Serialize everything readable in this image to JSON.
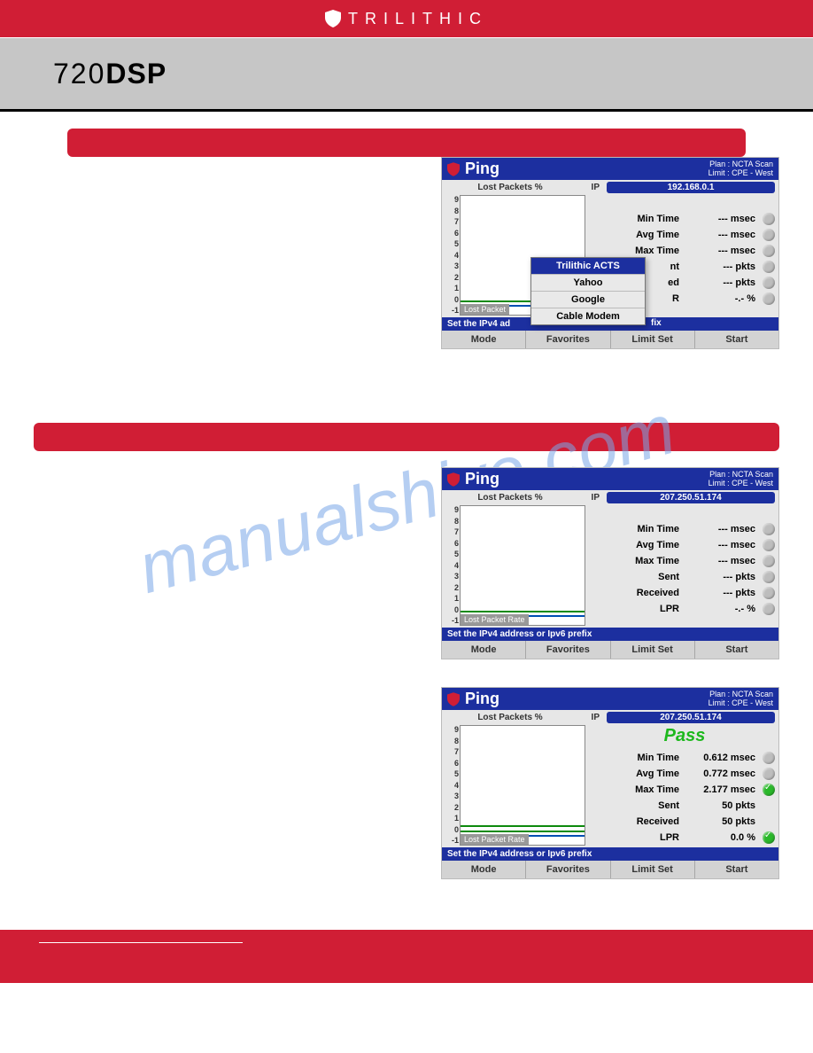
{
  "brand": "TRILITHIC",
  "product": {
    "num": "720",
    "suffix": "DSP"
  },
  "watermark": "manualshive.com",
  "ping_common": {
    "title": "Ping",
    "plan": "Plan : NCTA Scan",
    "limit": "Limit : CPE - West",
    "subhead_lpk": "Lost Packets %",
    "subhead_ip": "IP",
    "lpr_label": "Lost Packet Rate",
    "bluebar": "Set the IPv4 address or Ipv6 prefix",
    "bluebar_trunc": "Set the IPv4 ad",
    "bluebar_sfx": "fix",
    "softkeys": [
      "Mode",
      "Favorites",
      "Limit Set",
      "Start"
    ],
    "yticks": [
      "9",
      "8",
      "7",
      "6",
      "5",
      "4",
      "3",
      "2",
      "1",
      "0",
      "-1"
    ]
  },
  "favorites_menu": [
    "Trilithic ACTS",
    "Yahoo",
    "Google",
    "Cable Modem"
  ],
  "panels": [
    {
      "id": "p1",
      "offset_top": 0,
      "ip": "192.168.0.1",
      "has_favmenu": true,
      "trunc_bluebar": true,
      "rows": [
        {
          "label": "Min Time",
          "value": "--- msec",
          "stat": "gray"
        },
        {
          "label": "Avg Time",
          "value": "--- msec",
          "stat": "gray"
        },
        {
          "label": "Max Time",
          "value": "--- msec",
          "stat": "gray"
        },
        {
          "label": "nt",
          "value": "--- pkts",
          "stat": "gray",
          "half": true
        },
        {
          "label": "ed",
          "value": "--- pkts",
          "stat": "gray",
          "half": true
        },
        {
          "label": "R",
          "value": "-.- %",
          "stat": "gray",
          "half": true
        }
      ],
      "lines": [
        {
          "c": "lg",
          "b": 118
        },
        {
          "c": "lb",
          "b": 123
        }
      ],
      "lpr_short": "Lost Packet"
    },
    {
      "id": "p2",
      "offset_top": 0,
      "ip": "207.250.51.174",
      "has_favmenu": false,
      "trunc_bluebar": false,
      "rows": [
        {
          "label": "Min Time",
          "value": "--- msec",
          "stat": "gray"
        },
        {
          "label": "Avg Time",
          "value": "--- msec",
          "stat": "gray"
        },
        {
          "label": "Max Time",
          "value": "--- msec",
          "stat": "gray"
        },
        {
          "label": "Sent",
          "value": "--- pkts",
          "stat": "gray"
        },
        {
          "label": "Received",
          "value": "--- pkts",
          "stat": "gray"
        },
        {
          "label": "LPR",
          "value": "-.- %",
          "stat": "gray"
        }
      ],
      "lines": [
        {
          "c": "lg",
          "b": 118
        },
        {
          "c": "lb",
          "b": 123
        }
      ]
    },
    {
      "id": "p3",
      "offset_top": 18,
      "ip": "207.250.51.174",
      "has_favmenu": false,
      "trunc_bluebar": false,
      "pass": "Pass",
      "rows": [
        {
          "label": "Min Time",
          "value": "0.612 msec",
          "stat": "gray"
        },
        {
          "label": "Avg Time",
          "value": "0.772 msec",
          "stat": "gray"
        },
        {
          "label": "Max Time",
          "value": "2.177 msec",
          "stat": "ok"
        },
        {
          "label": "Sent",
          "value": "50 pkts",
          "stat": "none"
        },
        {
          "label": "Received",
          "value": "50 pkts",
          "stat": "none"
        },
        {
          "label": "LPR",
          "value": "0.0 %",
          "stat": "ok"
        }
      ],
      "lines": [
        {
          "c": "lg",
          "b": 112
        },
        {
          "c": "lg",
          "b": 118
        },
        {
          "c": "lb",
          "b": 123
        }
      ]
    }
  ],
  "chart_data": [
    {
      "type": "line",
      "title": "Lost Packets %",
      "ylim": [
        -1,
        9
      ],
      "x": [],
      "series": [
        {
          "name": "Lost Packet Rate %",
          "values": [
            0
          ]
        }
      ],
      "context": "panel p1 pre-test idle"
    },
    {
      "type": "line",
      "title": "Lost Packets %",
      "ylim": [
        -1,
        9
      ],
      "x": [],
      "series": [
        {
          "name": "Lost Packet Rate %",
          "values": [
            0
          ]
        }
      ],
      "context": "panel p2 pre-test idle"
    },
    {
      "type": "line",
      "title": "Lost Packets %",
      "ylim": [
        -1,
        9
      ],
      "x": [],
      "series": [
        {
          "name": "Lost Packet Rate %",
          "values": [
            0,
            0,
            0,
            0,
            0
          ]
        }
      ],
      "context": "panel p3 completed 50 sent / 50 received / 0.0% loss"
    }
  ]
}
